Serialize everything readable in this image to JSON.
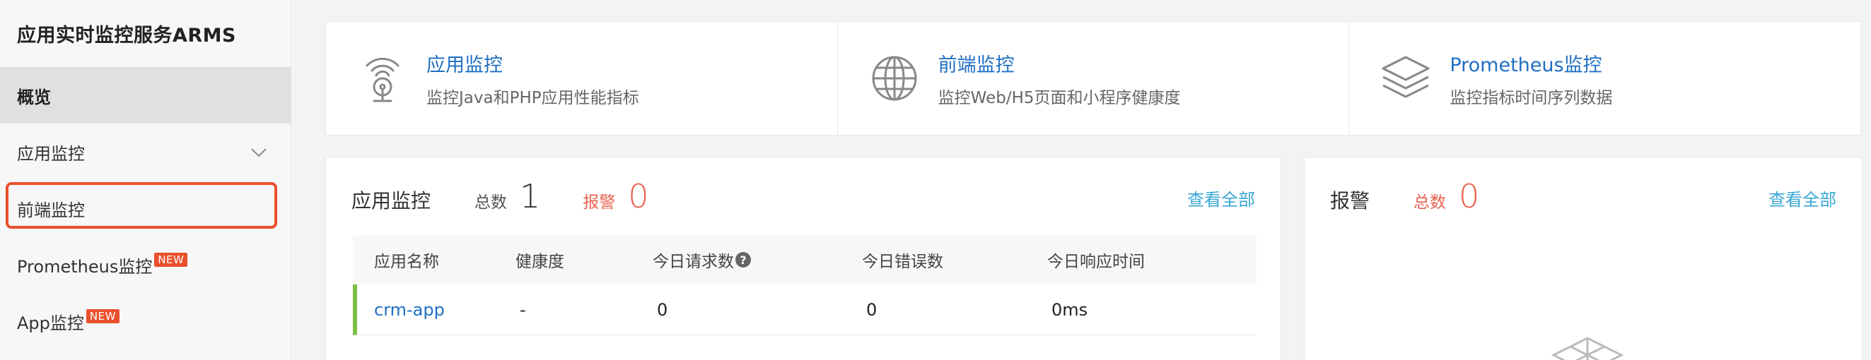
{
  "sidebar": {
    "title": "应用实时监控服务ARMS",
    "items": [
      {
        "label": "概览"
      },
      {
        "label": "应用监控"
      },
      {
        "label": "前端监控"
      },
      {
        "label": "Prometheus监控",
        "badge": "NEW"
      },
      {
        "label": "App监控",
        "badge": "NEW"
      }
    ]
  },
  "products": [
    {
      "title": "应用监控",
      "desc": "监控Java和PHP应用性能指标",
      "icon": "wifi-tower-icon"
    },
    {
      "title": "前端监控",
      "desc": "监控Web/H5页面和小程序健康度",
      "icon": "globe-icon"
    },
    {
      "title": "Prometheus监控",
      "desc": "监控指标时间序列数据",
      "icon": "layers-icon"
    }
  ],
  "app_panel": {
    "title": "应用监控",
    "total_label": "总数",
    "total_value": "1",
    "alert_label": "报警",
    "alert_value": "0",
    "view_all": "查看全部",
    "columns": [
      "应用名称",
      "健康度",
      "今日请求数",
      "今日错误数",
      "今日响应时间"
    ],
    "rows": [
      {
        "name": "crm-app",
        "health": "-",
        "requests": "0",
        "errors": "0",
        "response": "0ms"
      }
    ]
  },
  "alert_panel": {
    "title": "报警",
    "total_label": "总数",
    "total_value": "0",
    "view_all": "查看全部"
  },
  "colors": {
    "accent_link": "#1f6fc4",
    "alert_red": "#e8614f",
    "highlight_border": "#e8502c",
    "health_bar": "#7ac143"
  }
}
